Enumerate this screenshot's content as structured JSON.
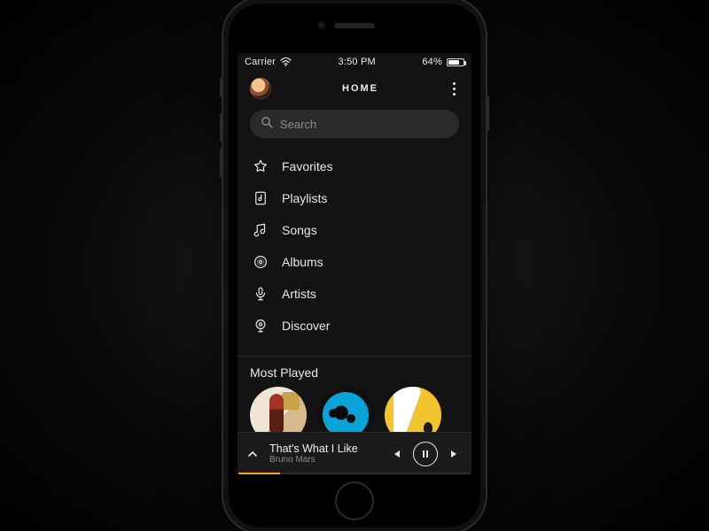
{
  "statusbar": {
    "carrier": "Carrier",
    "time": "3:50 PM",
    "battery_text": "64%",
    "battery_fill_pct": 64
  },
  "header": {
    "title": "HOME"
  },
  "search": {
    "placeholder": "Search"
  },
  "nav": {
    "items": [
      {
        "icon": "star-icon",
        "label": "Favorites"
      },
      {
        "icon": "playlist-icon",
        "label": "Playlists"
      },
      {
        "icon": "music-note-icon",
        "label": "Songs"
      },
      {
        "icon": "disc-icon",
        "label": "Albums"
      },
      {
        "icon": "mic-icon",
        "label": "Artists"
      },
      {
        "icon": "radar-icon",
        "label": "Discover"
      }
    ]
  },
  "section": {
    "most_played_title": "Most Played"
  },
  "nowplaying": {
    "title": "That's What I Like",
    "artist": "Bruno Mars",
    "progress_pct": 18,
    "accent_color": "#f5a623",
    "state": "playing"
  }
}
